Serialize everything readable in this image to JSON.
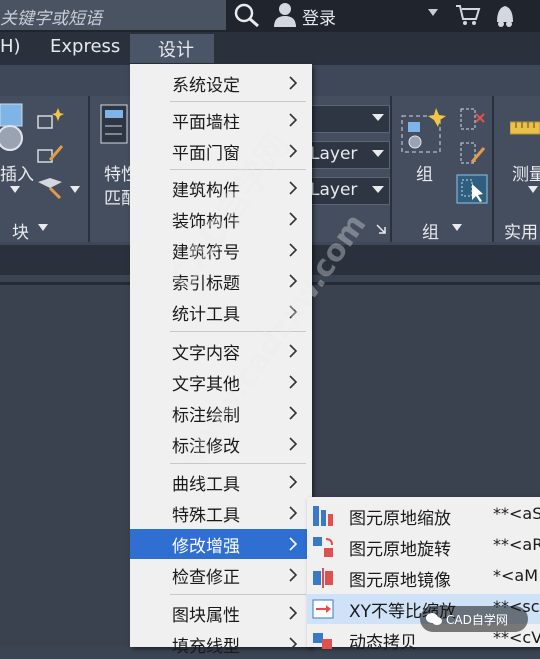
{
  "topbar": {
    "search_text": "关键字或短语",
    "login_label": "登录"
  },
  "menubar": {
    "items": [
      "H)",
      "Express",
      "设计"
    ]
  },
  "ribbon": {
    "insert_label": "插入",
    "block_panel_title": "块",
    "match_label_1": "特性",
    "match_label_2": "匹配",
    "layer_combo_1": "Layer",
    "layer_combo_2": "Layer",
    "group_label": "组",
    "group_panel_title": "组",
    "measure_label": "测量",
    "utility_panel_title": "实用"
  },
  "dropdown": {
    "items": [
      {
        "label": "系统设定"
      },
      {
        "label": "平面墙柱"
      },
      {
        "label": "平面门窗"
      },
      {
        "label": "建筑构件"
      },
      {
        "label": "装饰构件"
      },
      {
        "label": "建筑符号"
      },
      {
        "label": "索引标题"
      },
      {
        "label": "统计工具"
      },
      {
        "label": "文字内容"
      },
      {
        "label": "文字其他"
      },
      {
        "label": "标注绘制"
      },
      {
        "label": "标注修改"
      },
      {
        "label": "曲线工具"
      },
      {
        "label": "特殊工具"
      },
      {
        "label": "修改增强"
      },
      {
        "label": "检查修正"
      },
      {
        "label": "图块属性"
      },
      {
        "label": "填充线型"
      }
    ],
    "selected": "修改增强"
  },
  "submenu": {
    "items": [
      {
        "label": "图元原地缩放",
        "shortcut": "**<aS",
        "icon": "scale-in-place-icon"
      },
      {
        "label": "图元原地旋转",
        "shortcut": "**<aR",
        "icon": "rotate-in-place-icon"
      },
      {
        "label": "图元原地镜像",
        "shortcut": "*<aM",
        "icon": "mirror-in-place-icon"
      },
      {
        "label": "XY不等比缩放",
        "shortcut": "**<sc",
        "icon": "xy-scale-icon"
      },
      {
        "label": "动态拷贝",
        "shortcut": "**<cV>",
        "icon": "dynamic-copy-icon"
      }
    ],
    "selected": "XY不等比缩放"
  },
  "watermark": {
    "cn": "CAD自学网",
    "url": "www.cadzxw.com",
    "badge": "CAD自学网"
  },
  "colors": {
    "menu_highlight": "#2f6fd1",
    "submenu_highlight": "#cfe2f8",
    "ribbon_bg": "#444e5f"
  }
}
